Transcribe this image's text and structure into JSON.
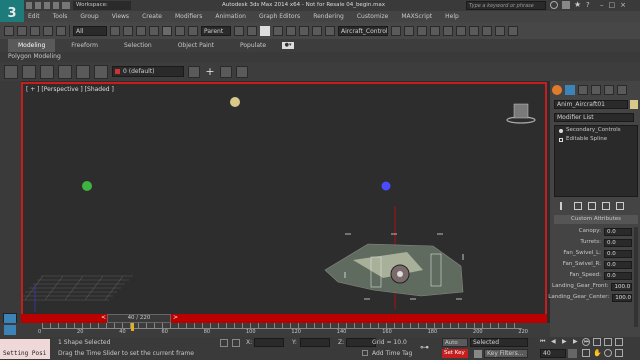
{
  "titlebar": {
    "workspace": "Workspace: Default",
    "title": "Autodesk 3ds Max  2014 x64  -  Not for Resale   04_begin.max",
    "search_placeholder": "Type a keyword or phrase"
  },
  "menu": [
    "Edit",
    "Tools",
    "Group",
    "Views",
    "Create",
    "Modifiers",
    "Animation",
    "Graph Editors",
    "Rendering",
    "Customize",
    "MAXScript",
    "Help"
  ],
  "maintoolbar": {
    "selection_filter": "All",
    "coordinate_system": "Parent",
    "named_selection": "Aircraft_Control"
  },
  "ribbon": {
    "tabs": [
      "Modeling",
      "Freeform",
      "Selection",
      "Object Paint",
      "Populate"
    ],
    "subtitle": "Polygon Modeling"
  },
  "layer": {
    "current": "0 (default)"
  },
  "viewport": {
    "label": "[ + ] [Perspective ] [Shaded ]"
  },
  "command_panel": {
    "object_name": "Anim_Aircraft01",
    "modifier_list": "Modifier List",
    "stack": [
      "Secondary_Controls",
      "Editable Spline"
    ],
    "rollout_title": "Custom Attributes",
    "params": [
      {
        "label": "Canopy:",
        "value": "0.0"
      },
      {
        "label": "Turrets:",
        "value": "0.0"
      },
      {
        "label": "Fan_Swivel_L:",
        "value": "0.0"
      },
      {
        "label": "Fan_Swivel_R:",
        "value": "0.0"
      },
      {
        "label": "Fan_Speed:",
        "value": "0.0"
      },
      {
        "label": "Landing_Gear_Front:",
        "value": "100.0"
      },
      {
        "label": "Landing_Gear_Center:",
        "value": "100.0"
      }
    ]
  },
  "timeslider": {
    "label": "40 / 220",
    "prev": "<",
    "next": ">"
  },
  "trackbar": {
    "ticks": [
      "0",
      "20",
      "40",
      "60",
      "80",
      "100",
      "120",
      "140",
      "160",
      "180",
      "200",
      "220"
    ]
  },
  "status": {
    "script_box": "Setting Posi",
    "line1": "1 Shape Selected",
    "line2": "Drag the Time Slider to set the current frame",
    "x_label": "X:",
    "y_label": "Y:",
    "z_label": "Z:",
    "grid": "Grid = 10.0",
    "add_time_tag": "Add Time Tag",
    "auto_key": "Auto Key",
    "auto_key_mode": "Selected",
    "set_key": "Set Key",
    "key_filters": "Key Filters...",
    "frame": "40"
  },
  "colors": {
    "accent_red": "#c41e1e",
    "teal_logo": "#1e7b7b"
  }
}
